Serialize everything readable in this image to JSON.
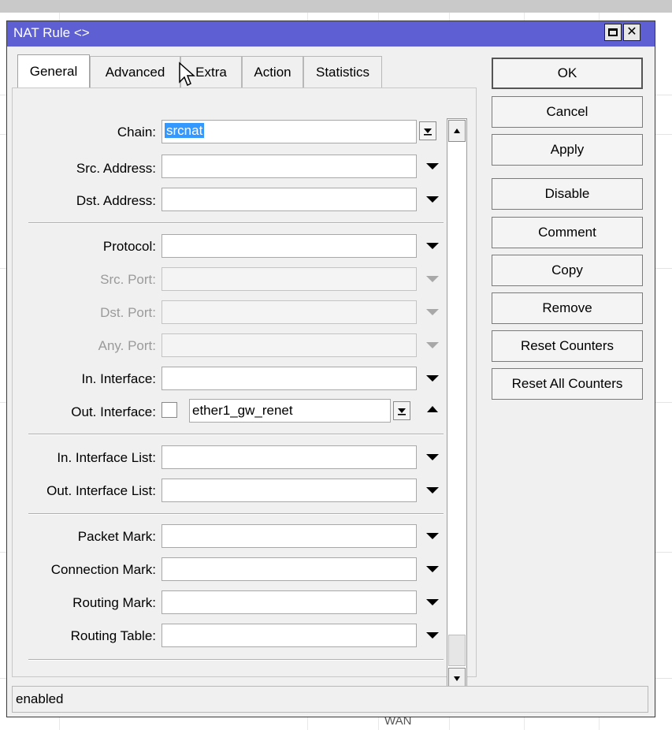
{
  "window": {
    "title": "NAT Rule <>",
    "status": "enabled"
  },
  "tabs": [
    "General",
    "Advanced",
    "Extra",
    "Action",
    "Statistics"
  ],
  "fields": {
    "chain": {
      "label": "Chain:",
      "value": "srcnat"
    },
    "src_address": {
      "label": "Src. Address:",
      "value": ""
    },
    "dst_address": {
      "label": "Dst. Address:",
      "value": ""
    },
    "protocol": {
      "label": "Protocol:",
      "value": ""
    },
    "src_port": {
      "label": "Src. Port:",
      "value": ""
    },
    "dst_port": {
      "label": "Dst. Port:",
      "value": ""
    },
    "any_port": {
      "label": "Any. Port:",
      "value": ""
    },
    "in_interface": {
      "label": "In. Interface:",
      "value": ""
    },
    "out_interface": {
      "label": "Out. Interface:",
      "value": "ether1_gw_renet",
      "negate": false
    },
    "in_interface_list": {
      "label": "In. Interface List:",
      "value": ""
    },
    "out_interface_list": {
      "label": "Out. Interface List:",
      "value": ""
    },
    "packet_mark": {
      "label": "Packet Mark:",
      "value": ""
    },
    "connection_mark": {
      "label": "Connection Mark:",
      "value": ""
    },
    "routing_mark": {
      "label": "Routing Mark:",
      "value": ""
    },
    "routing_table": {
      "label": "Routing Table:",
      "value": ""
    }
  },
  "buttons": {
    "ok": "OK",
    "cancel": "Cancel",
    "apply": "Apply",
    "disable": "Disable",
    "comment": "Comment",
    "copy": "Copy",
    "remove": "Remove",
    "reset_counters": "Reset Counters",
    "reset_all_counters": "Reset All Counters"
  },
  "background": {
    "wan_text": "WAN"
  },
  "colors": {
    "titlebar": "#5d5fd3",
    "selection": "#3399ff"
  }
}
